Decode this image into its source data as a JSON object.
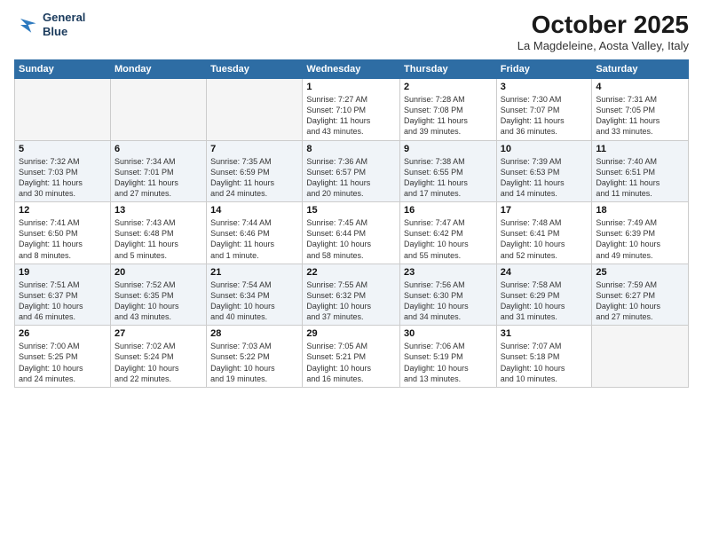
{
  "logo": {
    "line1": "General",
    "line2": "Blue"
  },
  "title": "October 2025",
  "location": "La Magdeleine, Aosta Valley, Italy",
  "weekdays": [
    "Sunday",
    "Monday",
    "Tuesday",
    "Wednesday",
    "Thursday",
    "Friday",
    "Saturday"
  ],
  "weeks": [
    [
      {
        "day": "",
        "info": ""
      },
      {
        "day": "",
        "info": ""
      },
      {
        "day": "",
        "info": ""
      },
      {
        "day": "1",
        "info": "Sunrise: 7:27 AM\nSunset: 7:10 PM\nDaylight: 11 hours\nand 43 minutes."
      },
      {
        "day": "2",
        "info": "Sunrise: 7:28 AM\nSunset: 7:08 PM\nDaylight: 11 hours\nand 39 minutes."
      },
      {
        "day": "3",
        "info": "Sunrise: 7:30 AM\nSunset: 7:07 PM\nDaylight: 11 hours\nand 36 minutes."
      },
      {
        "day": "4",
        "info": "Sunrise: 7:31 AM\nSunset: 7:05 PM\nDaylight: 11 hours\nand 33 minutes."
      }
    ],
    [
      {
        "day": "5",
        "info": "Sunrise: 7:32 AM\nSunset: 7:03 PM\nDaylight: 11 hours\nand 30 minutes."
      },
      {
        "day": "6",
        "info": "Sunrise: 7:34 AM\nSunset: 7:01 PM\nDaylight: 11 hours\nand 27 minutes."
      },
      {
        "day": "7",
        "info": "Sunrise: 7:35 AM\nSunset: 6:59 PM\nDaylight: 11 hours\nand 24 minutes."
      },
      {
        "day": "8",
        "info": "Sunrise: 7:36 AM\nSunset: 6:57 PM\nDaylight: 11 hours\nand 20 minutes."
      },
      {
        "day": "9",
        "info": "Sunrise: 7:38 AM\nSunset: 6:55 PM\nDaylight: 11 hours\nand 17 minutes."
      },
      {
        "day": "10",
        "info": "Sunrise: 7:39 AM\nSunset: 6:53 PM\nDaylight: 11 hours\nand 14 minutes."
      },
      {
        "day": "11",
        "info": "Sunrise: 7:40 AM\nSunset: 6:51 PM\nDaylight: 11 hours\nand 11 minutes."
      }
    ],
    [
      {
        "day": "12",
        "info": "Sunrise: 7:41 AM\nSunset: 6:50 PM\nDaylight: 11 hours\nand 8 minutes."
      },
      {
        "day": "13",
        "info": "Sunrise: 7:43 AM\nSunset: 6:48 PM\nDaylight: 11 hours\nand 5 minutes."
      },
      {
        "day": "14",
        "info": "Sunrise: 7:44 AM\nSunset: 6:46 PM\nDaylight: 11 hours\nand 1 minute."
      },
      {
        "day": "15",
        "info": "Sunrise: 7:45 AM\nSunset: 6:44 PM\nDaylight: 10 hours\nand 58 minutes."
      },
      {
        "day": "16",
        "info": "Sunrise: 7:47 AM\nSunset: 6:42 PM\nDaylight: 10 hours\nand 55 minutes."
      },
      {
        "day": "17",
        "info": "Sunrise: 7:48 AM\nSunset: 6:41 PM\nDaylight: 10 hours\nand 52 minutes."
      },
      {
        "day": "18",
        "info": "Sunrise: 7:49 AM\nSunset: 6:39 PM\nDaylight: 10 hours\nand 49 minutes."
      }
    ],
    [
      {
        "day": "19",
        "info": "Sunrise: 7:51 AM\nSunset: 6:37 PM\nDaylight: 10 hours\nand 46 minutes."
      },
      {
        "day": "20",
        "info": "Sunrise: 7:52 AM\nSunset: 6:35 PM\nDaylight: 10 hours\nand 43 minutes."
      },
      {
        "day": "21",
        "info": "Sunrise: 7:54 AM\nSunset: 6:34 PM\nDaylight: 10 hours\nand 40 minutes."
      },
      {
        "day": "22",
        "info": "Sunrise: 7:55 AM\nSunset: 6:32 PM\nDaylight: 10 hours\nand 37 minutes."
      },
      {
        "day": "23",
        "info": "Sunrise: 7:56 AM\nSunset: 6:30 PM\nDaylight: 10 hours\nand 34 minutes."
      },
      {
        "day": "24",
        "info": "Sunrise: 7:58 AM\nSunset: 6:29 PM\nDaylight: 10 hours\nand 31 minutes."
      },
      {
        "day": "25",
        "info": "Sunrise: 7:59 AM\nSunset: 6:27 PM\nDaylight: 10 hours\nand 27 minutes."
      }
    ],
    [
      {
        "day": "26",
        "info": "Sunrise: 7:00 AM\nSunset: 5:25 PM\nDaylight: 10 hours\nand 24 minutes."
      },
      {
        "day": "27",
        "info": "Sunrise: 7:02 AM\nSunset: 5:24 PM\nDaylight: 10 hours\nand 22 minutes."
      },
      {
        "day": "28",
        "info": "Sunrise: 7:03 AM\nSunset: 5:22 PM\nDaylight: 10 hours\nand 19 minutes."
      },
      {
        "day": "29",
        "info": "Sunrise: 7:05 AM\nSunset: 5:21 PM\nDaylight: 10 hours\nand 16 minutes."
      },
      {
        "day": "30",
        "info": "Sunrise: 7:06 AM\nSunset: 5:19 PM\nDaylight: 10 hours\nand 13 minutes."
      },
      {
        "day": "31",
        "info": "Sunrise: 7:07 AM\nSunset: 5:18 PM\nDaylight: 10 hours\nand 10 minutes."
      },
      {
        "day": "",
        "info": ""
      }
    ]
  ]
}
